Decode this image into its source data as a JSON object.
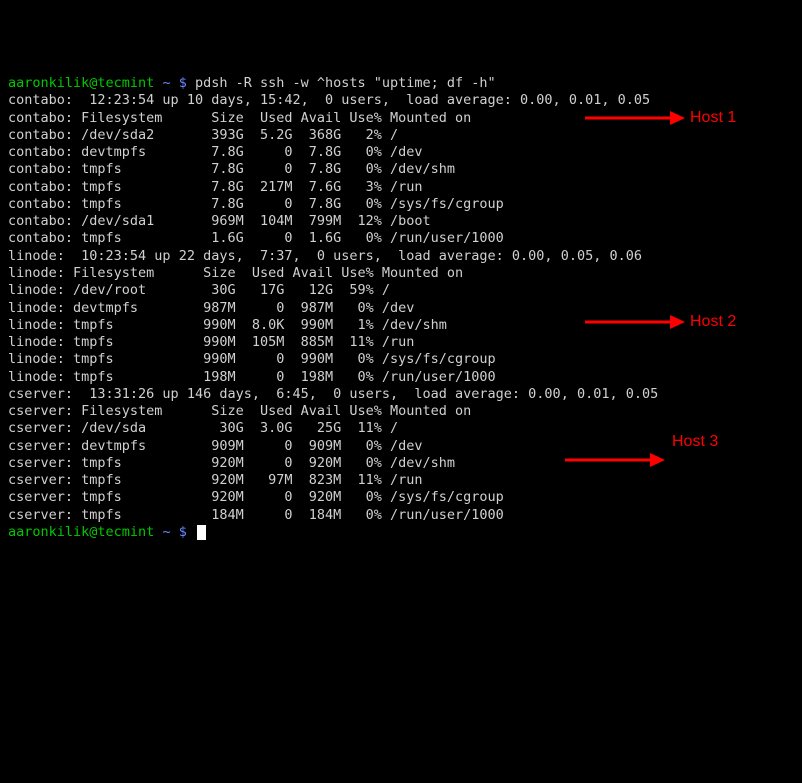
{
  "prompt": {
    "user_host": "aaronkilik@tecmint",
    "path": " ~ $ ",
    "command": "pdsh -R ssh -w ^hosts \"uptime; df -h\""
  },
  "hosts": [
    {
      "name": "contabo",
      "uptime": " 12:23:54 up 10 days, 15:42,  0 users,  load average: 0.00, 0.01, 0.05",
      "header": "Filesystem      Size  Used Avail Use% Mounted on",
      "rows": [
        "/dev/sda2       393G  5.2G  368G   2% /",
        "devtmpfs        7.8G     0  7.8G   0% /dev",
        "tmpfs           7.8G     0  7.8G   0% /dev/shm",
        "tmpfs           7.8G  217M  7.6G   3% /run",
        "tmpfs           7.8G     0  7.8G   0% /sys/fs/cgroup",
        "/dev/sda1       969M  104M  799M  12% /boot",
        "tmpfs           1.6G     0  1.6G   0% /run/user/1000"
      ]
    },
    {
      "name": "linode",
      "uptime": " 10:23:54 up 22 days,  7:37,  0 users,  load average: 0.00, 0.05, 0.06",
      "header": "Filesystem      Size  Used Avail Use% Mounted on",
      "rows": [
        "/dev/root        30G   17G   12G  59% /",
        "devtmpfs        987M     0  987M   0% /dev",
        "tmpfs           990M  8.0K  990M   1% /dev/shm",
        "tmpfs           990M  105M  885M  11% /run",
        "tmpfs           990M     0  990M   0% /sys/fs/cgroup",
        "tmpfs           198M     0  198M   0% /run/user/1000"
      ]
    },
    {
      "name": "cserver",
      "uptime": " 13:31:26 up 146 days,  6:45,  0 users,  load average: 0.00, 0.01, 0.05",
      "header": "Filesystem      Size  Used Avail Use% Mounted on",
      "rows": [
        "/dev/sda         30G  3.0G   25G  11% /",
        "devtmpfs        909M     0  909M   0% /dev",
        "tmpfs           920M     0  920M   0% /dev/shm",
        "tmpfs           920M   97M  823M  11% /run",
        "tmpfs           920M     0  920M   0% /sys/fs/cgroup",
        "tmpfs           184M     0  184M   0% /run/user/1000"
      ]
    }
  ],
  "annotations": {
    "host1": "Host 1",
    "host2": "Host 2",
    "host3": "Host 3"
  }
}
